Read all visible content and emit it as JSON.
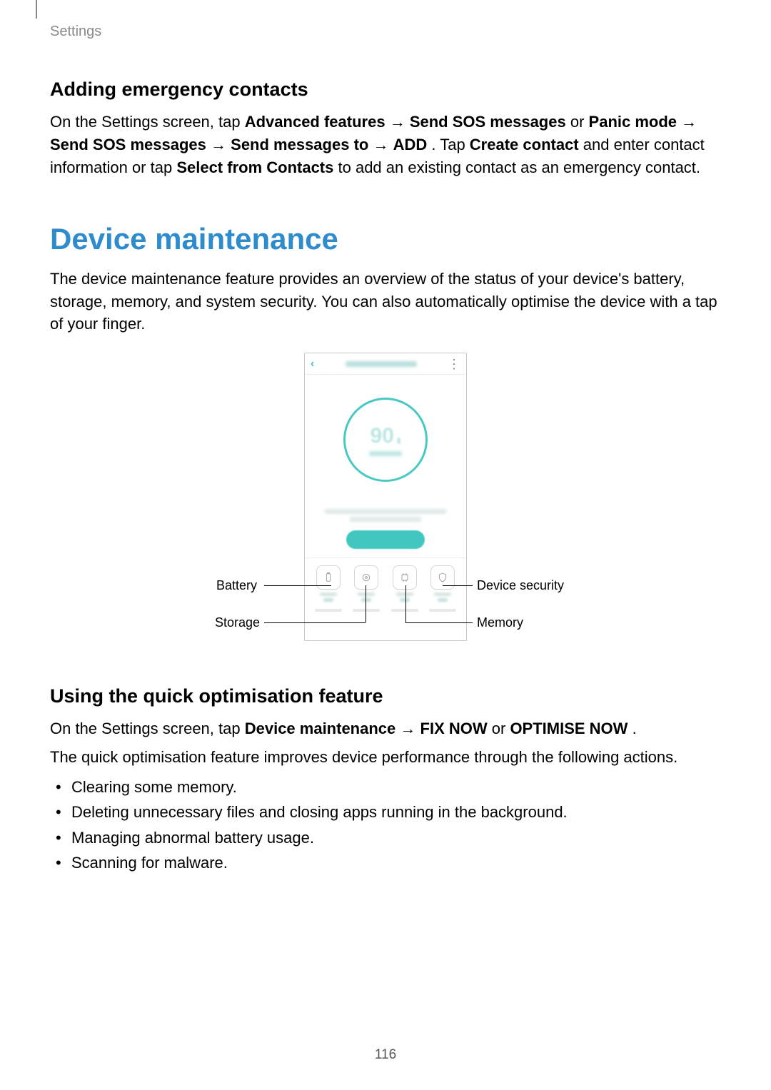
{
  "header": {
    "section": "Settings"
  },
  "section1": {
    "heading": "Adding emergency contacts",
    "p_parts": {
      "a": "On the Settings screen, tap ",
      "b": "Advanced features",
      "arr1": " → ",
      "c": "Send SOS messages",
      "d": " or ",
      "e": "Panic mode",
      "arr2": " → ",
      "f": "Send SOS messages",
      "arr3": " → ",
      "g": "Send messages to",
      "arr4": " → ",
      "h": "ADD",
      "i": ". Tap ",
      "j": "Create contact",
      "k": " and enter contact information or tap ",
      "l": "Select from Contacts",
      "m": " to add an existing contact as an emergency contact."
    }
  },
  "device_maintenance": {
    "heading": "Device maintenance",
    "intro": "The device maintenance feature provides an overview of the status of your device's battery, storage, memory, and system security. You can also automatically optimise the device with a tap of your finger."
  },
  "figure": {
    "score": "90",
    "callouts": {
      "battery": "Battery",
      "storage": "Storage",
      "security": "Device security",
      "memory": "Memory"
    }
  },
  "quick_opt": {
    "heading": "Using the quick optimisation feature",
    "p1_parts": {
      "a": "On the Settings screen, tap ",
      "b": "Device maintenance",
      "arr": " → ",
      "c": "FIX NOW",
      "d": " or ",
      "e": "OPTIMISE NOW",
      "f": "."
    },
    "p2": "The quick optimisation feature improves device performance through the following actions.",
    "bullets": [
      "Clearing some memory.",
      "Deleting unnecessary files and closing apps running in the background.",
      "Managing abnormal battery usage.",
      "Scanning for malware."
    ]
  },
  "page_number": "116"
}
